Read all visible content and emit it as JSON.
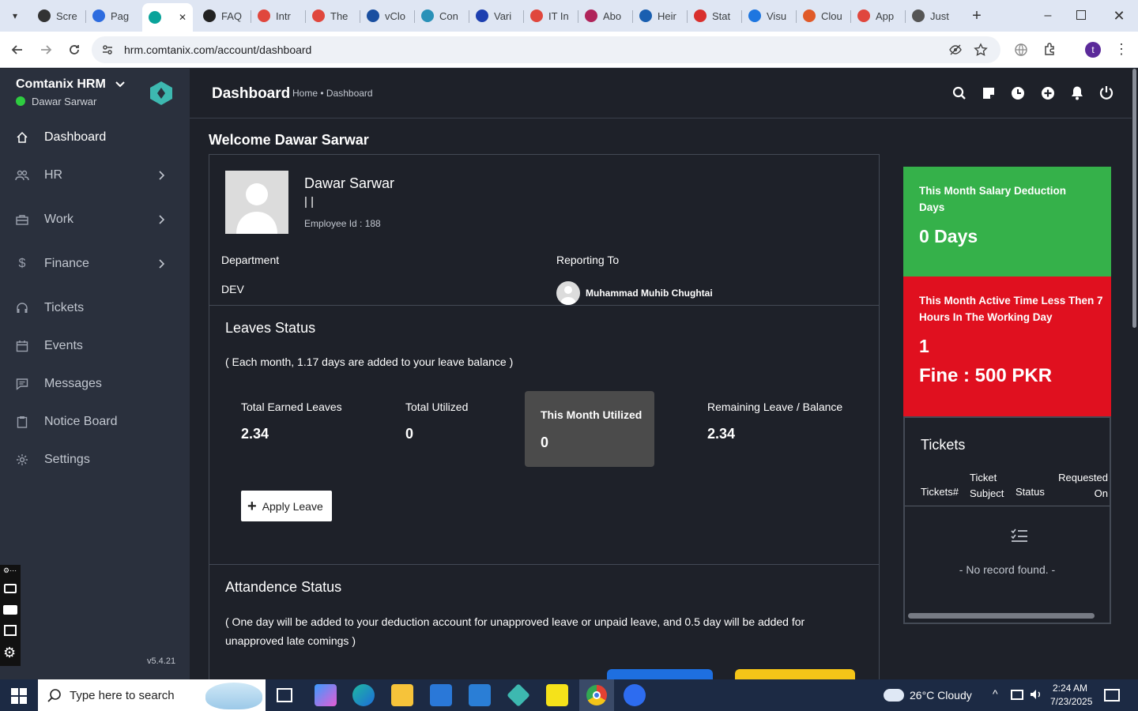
{
  "browser": {
    "tabs": [
      {
        "label": "Scre",
        "color": "#333"
      },
      {
        "label": "Pag",
        "color": "#2d6cdf"
      },
      {
        "label": "",
        "color": "#0aa39a"
      },
      {
        "label": "FAQ",
        "color": "#222"
      },
      {
        "label": "Intr",
        "color": "#e0473d"
      },
      {
        "label": "The",
        "color": "#e0473d"
      },
      {
        "label": "vClo",
        "color": "#1a4fa0"
      },
      {
        "label": "Con",
        "color": "#2a91b8"
      },
      {
        "label": "Vari",
        "color": "#1d3fb0"
      },
      {
        "label": "IT In",
        "color": "#e0473d"
      },
      {
        "label": "Abo",
        "color": "#b0245a"
      },
      {
        "label": "Heir",
        "color": "#1a5fb0"
      },
      {
        "label": "Stat",
        "color": "#d9302d"
      },
      {
        "label": "Visu",
        "color": "#1e76e0"
      },
      {
        "label": "Clou",
        "color": "#e05a28"
      },
      {
        "label": "App",
        "color": "#e0473d"
      },
      {
        "label": "Just",
        "color": "#555"
      }
    ],
    "url": "hrm.comtanix.com/account/dashboard",
    "profile_initial": "t"
  },
  "sidebar": {
    "brand": "Comtanix HRM",
    "user": "Dawar Sarwar",
    "version": "v5.4.21",
    "items": [
      {
        "label": "Dashboard",
        "icon": "home-icon"
      },
      {
        "label": "HR",
        "icon": "users-icon"
      },
      {
        "label": "Work",
        "icon": "briefcase-icon"
      },
      {
        "label": "Finance",
        "icon": "dollar-icon"
      },
      {
        "label": "Tickets",
        "icon": "headset-icon"
      },
      {
        "label": "Events",
        "icon": "calendar-icon"
      },
      {
        "label": "Messages",
        "icon": "message-icon"
      },
      {
        "label": "Notice Board",
        "icon": "clipboard-icon"
      },
      {
        "label": "Settings",
        "icon": "gear-icon"
      }
    ]
  },
  "header": {
    "title": "Dashboard",
    "breadcrumb": "Home • Dashboard"
  },
  "main": {
    "welcome": "Welcome Dawar Sarwar",
    "profile": {
      "name": "Dawar Sarwar",
      "separator": "| |",
      "employee_id": "Employee Id : 188",
      "department_label": "Department",
      "department_value": "DEV",
      "reporting_label": "Reporting To",
      "reporting_value": "Muhammad Muhib Chughtai"
    },
    "leaves": {
      "title": "Leaves Status",
      "note": "( Each month, 1.17 days are added to your leave balance )",
      "stats": [
        {
          "label": "Total Earned Leaves",
          "value": "2.34"
        },
        {
          "label": "Total Utilized",
          "value": "0"
        },
        {
          "label": "This Month Utilized",
          "value": "0"
        },
        {
          "label": "Remaining Leave / Balance",
          "value": "2.34"
        }
      ],
      "apply_label": "Apply Leave"
    },
    "attendance": {
      "title": "Attandence Status",
      "note": "( One day will be added to your deduction account for unapproved leave or unpaid leave, and 0.5 day will be added for unapproved late comings )"
    }
  },
  "right": {
    "salary_card": {
      "title": "This Month Salary Deduction Days",
      "value": "0 Days",
      "color": "#35b14a"
    },
    "time_card": {
      "title": "This Month Active Time Less Then 7 Hours In The Working Day",
      "value": "1",
      "fine": "Fine : 500 PKR",
      "color": "#e0101f"
    },
    "tickets": {
      "title": "Tickets",
      "columns": [
        "Tickets#",
        "Ticket Subject",
        "Status",
        "Requested On"
      ],
      "empty": "- No record found. -"
    }
  },
  "taskbar": {
    "search_placeholder": "Type here to search",
    "weather": "26°C  Cloudy",
    "time": "2:24 AM",
    "date": "7/23/2025"
  }
}
